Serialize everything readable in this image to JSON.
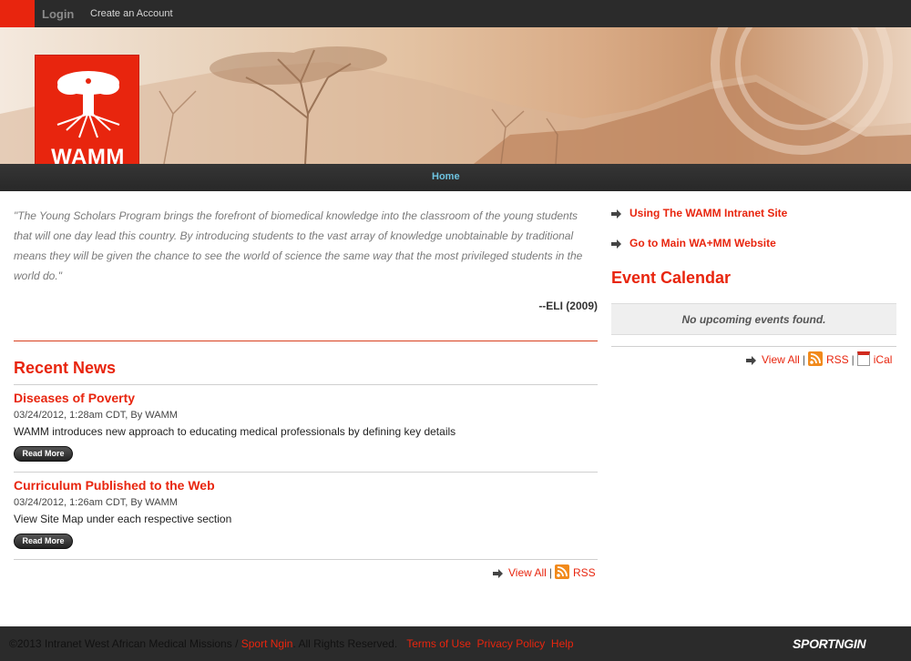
{
  "topbar": {
    "login_label": "Login",
    "create_account_label": "Create an Account"
  },
  "logo": {
    "text": "WAMM"
  },
  "nav": {
    "home_label": "Home"
  },
  "quote": {
    "text": "\"The Young Scholars Program brings the forefront of biomedical knowledge into the classroom of the young students that will one day lead this country. By introducing students to the vast array of knowledge unobtainable by traditional means they will be given the chance to see the world of science the same way that the most privileged students in the world do.\"",
    "author": "--ELI (2009)"
  },
  "recent_news": {
    "title": "Recent News",
    "items": [
      {
        "title": "Diseases of Poverty",
        "meta": "03/24/2012, 1:28am CDT, By WAMM",
        "summary": "WAMM introduces new approach to educating medical professionals by defining key details",
        "read_more": "Read More"
      },
      {
        "title": "Curriculum Published to the Web",
        "meta": "03/24/2012, 1:26am CDT, By WAMM",
        "summary": "View Site Map under each respective section",
        "read_more": "Read More"
      }
    ],
    "view_all": "View All",
    "separator": "|",
    "rss": "RSS"
  },
  "sidebar": {
    "links": [
      {
        "label": "Using The WAMM Intranet Site"
      },
      {
        "label": "Go to Main WA+MM Website"
      }
    ],
    "event_calendar_title": "Event Calendar",
    "no_events": "No upcoming events found.",
    "view_all": "View All",
    "separator": "|",
    "rss": "RSS",
    "ical": "iCal"
  },
  "footer": {
    "copyright": "©2013 Intranet West African Medical Missions /",
    "sportngin_link": "Sport Ngin",
    "rights": ". All Rights Reserved.",
    "terms": "Terms of Use",
    "privacy": "Privacy Policy",
    "help": "Help",
    "brand": "SPORTNGIN"
  },
  "colors": {
    "accent": "#e8250e",
    "nav_link": "#6ec3e0",
    "bar": "#2b2b2b"
  }
}
